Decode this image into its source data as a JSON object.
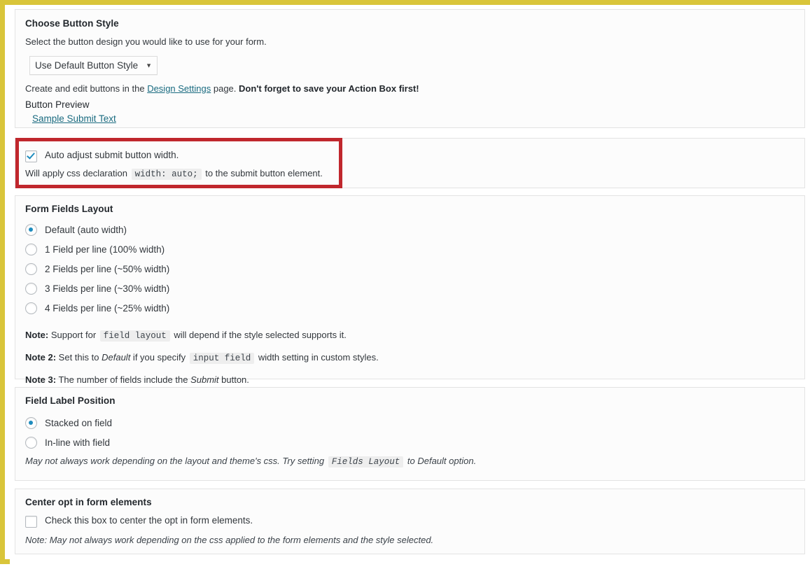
{
  "theme": {
    "outer_border_color": "#d9c53a",
    "highlight_color": "#c0272d",
    "accent_color": "#1e8cbe",
    "link_color": "#1a6b80",
    "panel_bg": "#fcfcfc",
    "panel_border": "#e3e3e3"
  },
  "button_style": {
    "title": "Choose Button Style",
    "description": "Select the button design you would like to use for your form.",
    "select_value": "Use Default Button Style",
    "select_options": [
      "Use Default Button Style"
    ],
    "dropdown_icon": "chevron-down-icon",
    "helper_prefix": "Create and edit buttons in the ",
    "helper_link": "Design Settings",
    "helper_mid": " page. ",
    "helper_bold": "Don't forget to save your Action Box first!",
    "preview_label": "Button Preview",
    "preview_link": "Sample Submit Text"
  },
  "auto_width": {
    "checkbox_checked": true,
    "checkbox_label": "Auto adjust submit button width.",
    "sub_prefix": "Will apply css declaration",
    "sub_code": "width: auto;",
    "sub_suffix": "to the submit button element."
  },
  "fields_layout": {
    "title": "Form Fields Layout",
    "selected_index": 0,
    "options": [
      "Default (auto width)",
      "1 Field per line (100% width)",
      "2 Fields per line (~50% width)",
      "3 Fields per line (~30% width)",
      "4 Fields per line (~25% width)"
    ],
    "note1_label": "Note:",
    "note1_a": " Support for ",
    "note1_code": "field layout",
    "note1_b": " will depend if the style selected supports it.",
    "note2_label": "Note 2:",
    "note2_a": " Set this to ",
    "note2_italic": "Default",
    "note2_b": " if you specify ",
    "note2_code": "input field",
    "note2_c": " width setting in custom styles.",
    "note3_label": "Note 3:",
    "note3_a": " The number of fields include the ",
    "note3_italic": "Submit",
    "note3_b": " button."
  },
  "label_position": {
    "title": "Field Label Position",
    "selected_index": 0,
    "options": [
      "Stacked on field",
      "In-line with field"
    ],
    "note_a": "May not always work depending on the layout and theme's css. Try setting ",
    "note_code": "Fields Layout",
    "note_b": " to Default option."
  },
  "center_elements": {
    "title": "Center opt in form elements",
    "checkbox_checked": false,
    "checkbox_label": "Check this box to center the opt in form elements.",
    "note_label": "Note:",
    "note_text": " May not always work depending on the css applied to the form elements and the style selected."
  }
}
